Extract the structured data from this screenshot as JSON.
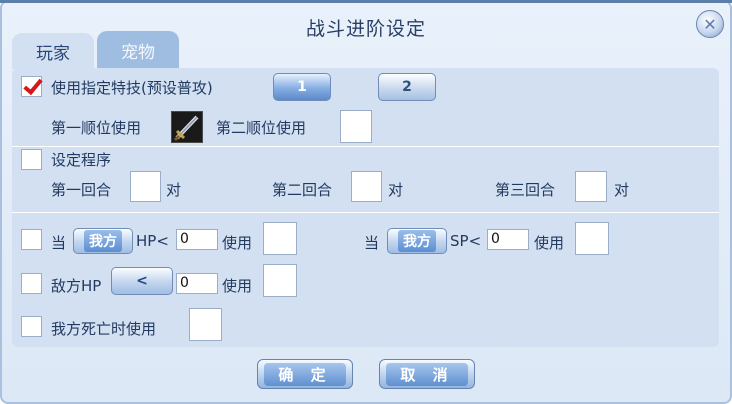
{
  "window": {
    "title": "战斗进阶设定",
    "close_icon": "close-icon"
  },
  "tabs": [
    {
      "label": "玩家",
      "active": true
    },
    {
      "label": "宠物",
      "active": false
    }
  ],
  "skill": {
    "checkbox_checked": true,
    "label": "使用指定特技(预设普攻)",
    "buttons": [
      "1",
      "2"
    ],
    "first_slot_label": "第一顺位使用",
    "second_slot_label": "第二顺位使用",
    "first_slot_icon": "sword-icon"
  },
  "program": {
    "checkbox_checked": false,
    "label": "设定程序",
    "round1_label": "第一回合",
    "round2_label": "第二回合",
    "round3_label": "第三回合",
    "target_label": "对"
  },
  "conditions": {
    "hp_prefix": "当",
    "hp_target": "我方",
    "hp_label": "HP<",
    "hp_value": "0",
    "sp_prefix": "当",
    "sp_target": "我方",
    "sp_label": "SP<",
    "sp_value": "0",
    "use_label": "使用",
    "enemy_hp_label": "敌方HP",
    "compare_symbol": "<",
    "enemy_hp_value": "0",
    "death_label": "我方死亡时使用"
  },
  "footer": {
    "confirm": "确 定",
    "cancel": "取 消"
  },
  "colors": {
    "accent": "#5b8fd2",
    "check": "#d3171c",
    "panel": "#d2e0f1"
  }
}
